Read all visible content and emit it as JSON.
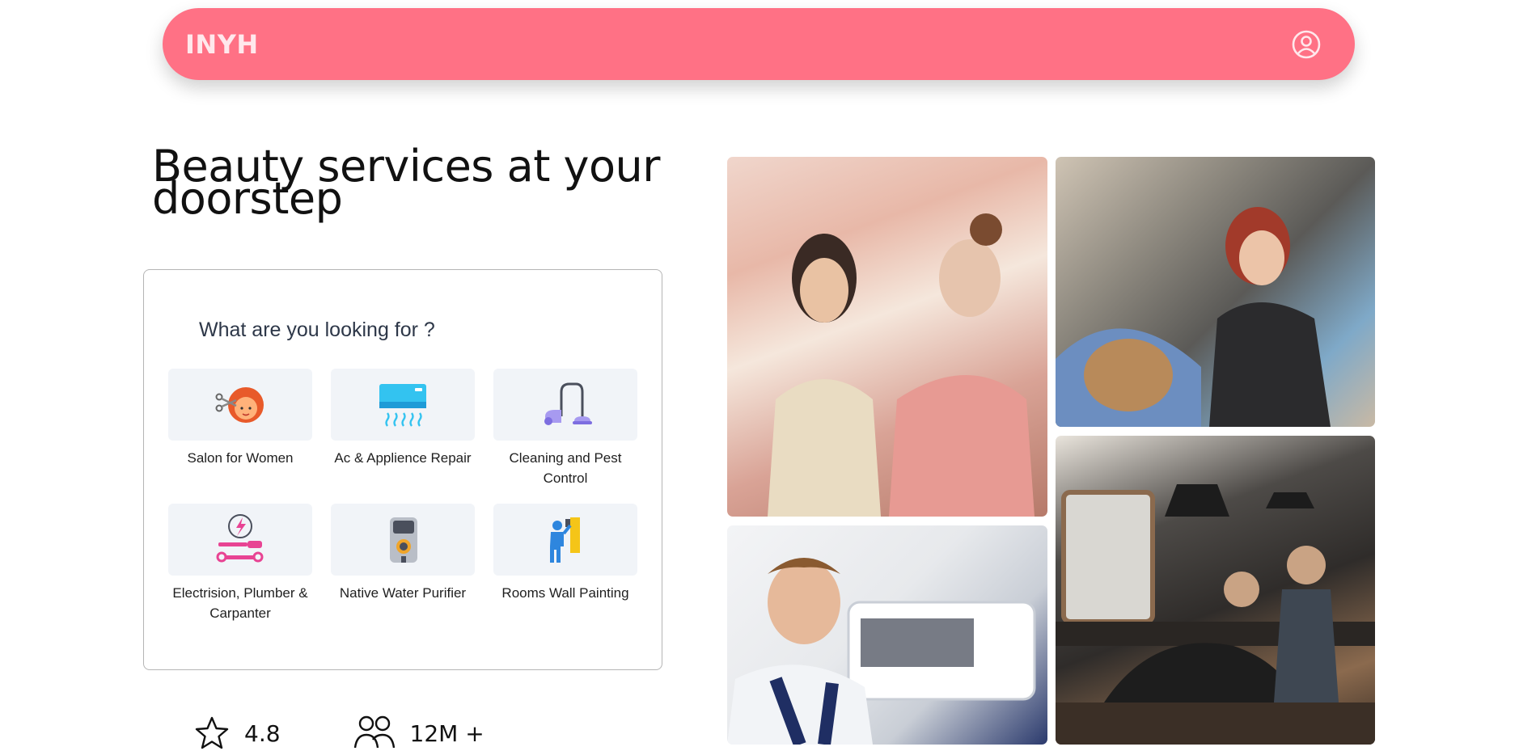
{
  "header": {
    "logo": "INYH",
    "profile_icon": "user-circle-icon"
  },
  "hero": {
    "title": "Beauty services at your doorstep"
  },
  "services_card": {
    "title": "What are you looking for ?",
    "items": [
      {
        "label": "Salon for Women",
        "icon": "salon-woman-icon"
      },
      {
        "label": "Ac & Applience Repair",
        "icon": "air-conditioner-icon"
      },
      {
        "label": "Cleaning and Pest Control",
        "icon": "vacuum-cleaner-icon"
      },
      {
        "label": "Electrision, Plumber & Carpanter",
        "icon": "tools-icon"
      },
      {
        "label": "Native Water Purifier",
        "icon": "water-purifier-icon"
      },
      {
        "label": "Rooms Wall Painting",
        "icon": "painter-icon"
      }
    ]
  },
  "stats": [
    {
      "value": "4.8",
      "icon": "star-icon"
    },
    {
      "value": "12M +",
      "icon": "users-icon"
    }
  ],
  "gallery": [
    {
      "subject": "makeup-artist-photo"
    },
    {
      "subject": "tattoo-artist-photo"
    },
    {
      "subject": "ac-technician-photo"
    },
    {
      "subject": "barbershop-photo"
    }
  ],
  "colors": {
    "accent": "#ff7185",
    "tile_bg": "#f1f4f8",
    "card_border": "#b5b5b5"
  }
}
